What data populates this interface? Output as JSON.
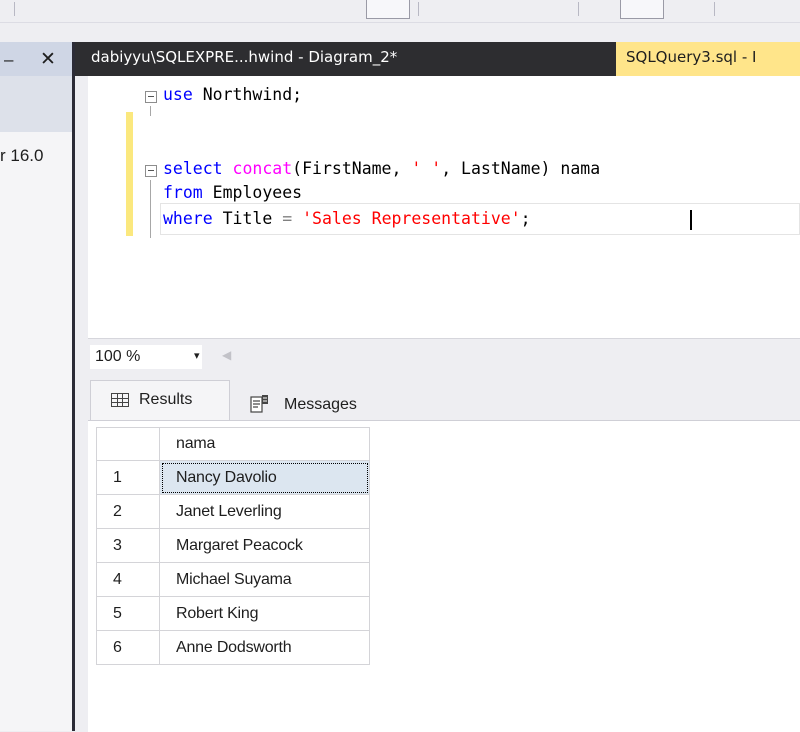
{
  "toolbar": {},
  "left_panel": {
    "caption_fragment": "–",
    "close_glyph": "✕",
    "node_fragment": "r 16.0"
  },
  "tabs": {
    "diagram_tab": "dabiyyu\\SQLEXPRE...hwind - Diagram_2*",
    "query_tab": "SQLQuery3.sql - I"
  },
  "editor": {
    "lines": [
      [
        "use",
        " Northwind;"
      ],
      [],
      [
        "select",
        "concat",
        "(FirstName, ",
        "' '",
        ", LastName) nama"
      ],
      [
        "from",
        " Employees"
      ],
      [
        "where",
        " Title ",
        "=",
        " ",
        "'Sales Representative'",
        ";"
      ]
    ]
  },
  "zoom": {
    "value": "100 %",
    "arrow": "▾",
    "scroll_left": "◀"
  },
  "result_tabs": {
    "results_label": "Results",
    "messages_label": "Messages"
  },
  "results": {
    "columns": [
      "nama"
    ],
    "rows": [
      {
        "num": "1",
        "nama": "Nancy Davolio"
      },
      {
        "num": "2",
        "nama": "Janet Leverling"
      },
      {
        "num": "3",
        "nama": "Margaret Peacock"
      },
      {
        "num": "4",
        "nama": "Michael Suyama"
      },
      {
        "num": "5",
        "nama": "Robert King"
      },
      {
        "num": "6",
        "nama": "Anne Dodsworth"
      }
    ]
  }
}
